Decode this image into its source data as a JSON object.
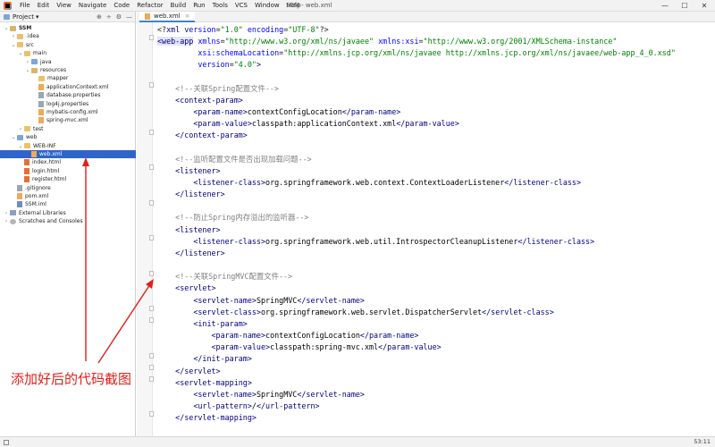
{
  "menu": {
    "items": [
      "File",
      "Edit",
      "View",
      "Navigate",
      "Code",
      "Refactor",
      "Build",
      "Run",
      "Tools",
      "VCS",
      "Window",
      "Help"
    ],
    "window_title": "SSM - web.xml",
    "minimize": "—",
    "maximize": "☐",
    "close": "✕"
  },
  "project_panel": {
    "label": "Project",
    "dropdown": "▾",
    "icons": [
      "⊕",
      "÷",
      "⚙",
      "—"
    ]
  },
  "tree": [
    {
      "label": "SSM",
      "arrow": "v",
      "icon": "folder-gold",
      "bold": true
    },
    {
      "label": ".idea",
      "arrow": ">",
      "icon": "folder"
    },
    {
      "label": "src",
      "arrow": "v",
      "icon": "folder"
    },
    {
      "label": "main",
      "arrow": "v",
      "icon": "folder"
    },
    {
      "label": "java",
      "arrow": ">",
      "icon": "folder-blue"
    },
    {
      "label": "resources",
      "arrow": "v",
      "icon": "folder-gold"
    },
    {
      "label": "mapper",
      "arrow": "",
      "icon": "folder"
    },
    {
      "label": "applicationContext.xml",
      "arrow": "",
      "icon": "file-xml"
    },
    {
      "label": "database.properties",
      "arrow": "",
      "icon": "file-prop"
    },
    {
      "label": "log4j.properties",
      "arrow": "",
      "icon": "file-prop"
    },
    {
      "label": "mybatis-config.xml",
      "arrow": "",
      "icon": "file-xml"
    },
    {
      "label": "spring-mvc.xml",
      "arrow": "",
      "icon": "file-xml"
    },
    {
      "label": "test",
      "arrow": ">",
      "icon": "folder"
    },
    {
      "label": "web",
      "arrow": "v",
      "icon": "folder-blue"
    },
    {
      "label": "WEB-INF",
      "arrow": "v",
      "icon": "folder"
    },
    {
      "label": "web.xml",
      "arrow": "",
      "icon": "file-xml",
      "selected": true
    },
    {
      "label": "index.html",
      "arrow": "",
      "icon": "file-html"
    },
    {
      "label": "login.html",
      "arrow": "",
      "icon": "file-html"
    },
    {
      "label": "register.html",
      "arrow": "",
      "icon": "file-html"
    },
    {
      "label": ".gitignore",
      "arrow": "",
      "icon": "file-prop"
    },
    {
      "label": "pom.xml",
      "arrow": "",
      "icon": "file-xml"
    },
    {
      "label": "SSM.iml",
      "arrow": "",
      "icon": "file-iml"
    },
    {
      "label": "External Libraries",
      "arrow": ">",
      "icon": "lib"
    },
    {
      "label": "Scratches and Consoles",
      "arrow": ">",
      "icon": "scratch"
    }
  ],
  "editor": {
    "tab_label": "web.xml",
    "tab_close": "×"
  },
  "code_lines": [
    [
      [
        "t",
        "<?"
      ],
      [
        "tag",
        "xml "
      ],
      [
        "attr",
        "version"
      ],
      [
        "t",
        "="
      ],
      [
        "val",
        "\"1.0\""
      ],
      [
        "t",
        " "
      ],
      [
        "attr",
        "encoding"
      ],
      [
        "t",
        "="
      ],
      [
        "val",
        "\"UTF-8\""
      ],
      [
        "t",
        "?>"
      ]
    ],
    [
      [
        "tag hl",
        "<web-app"
      ],
      [
        "t",
        " "
      ],
      [
        "attr",
        "xmlns"
      ],
      [
        "t",
        "="
      ],
      [
        "val",
        "\"http://www.w3.org/xml/ns/javaee\""
      ],
      [
        "t",
        " "
      ],
      [
        "attr",
        "xmlns:xsi"
      ],
      [
        "t",
        "="
      ],
      [
        "val",
        "\"http://www.w3.org/2001/XMLSchema-instance\""
      ]
    ],
    [
      [
        "t",
        "         "
      ],
      [
        "attr",
        "xsi:schemaLocation"
      ],
      [
        "t",
        "="
      ],
      [
        "val",
        "\"http://xmlns.jcp.org/xml/ns/javaee http://xmlns.jcp.org/xml/ns/javaee/web-app_4_0.xsd\""
      ]
    ],
    [
      [
        "t",
        "         "
      ],
      [
        "attr",
        "version"
      ],
      [
        "t",
        "="
      ],
      [
        "val",
        "\"4.0\""
      ],
      [
        "tag",
        ">"
      ]
    ],
    [],
    [
      [
        "t",
        "    "
      ],
      [
        "cmt",
        "<!--关联Spring配置文件-->"
      ]
    ],
    [
      [
        "t",
        "    "
      ],
      [
        "tag",
        "<context-param>"
      ]
    ],
    [
      [
        "t",
        "        "
      ],
      [
        "tag",
        "<param-name>"
      ],
      [
        "txt",
        "contextConfigLocation"
      ],
      [
        "tag",
        "</param-name>"
      ]
    ],
    [
      [
        "t",
        "        "
      ],
      [
        "tag",
        "<param-value>"
      ],
      [
        "txt",
        "classpath:applicationContext.xml"
      ],
      [
        "tag",
        "</param-value>"
      ]
    ],
    [
      [
        "t",
        "    "
      ],
      [
        "tag",
        "</context-param>"
      ]
    ],
    [],
    [
      [
        "t",
        "    "
      ],
      [
        "cmt",
        "<!--监听配置文件是否出现加载问题-->"
      ]
    ],
    [
      [
        "t",
        "    "
      ],
      [
        "tag",
        "<listener>"
      ]
    ],
    [
      [
        "t",
        "        "
      ],
      [
        "tag",
        "<listener-class>"
      ],
      [
        "txt",
        "org.springframework.web.context.ContextLoaderListener"
      ],
      [
        "tag",
        "</listener-class>"
      ]
    ],
    [
      [
        "t",
        "    "
      ],
      [
        "tag",
        "</listener>"
      ]
    ],
    [],
    [
      [
        "t",
        "    "
      ],
      [
        "cmt",
        "<!--防止Spring内存溢出的监听器-->"
      ]
    ],
    [
      [
        "t",
        "    "
      ],
      [
        "tag",
        "<listener>"
      ]
    ],
    [
      [
        "t",
        "        "
      ],
      [
        "tag",
        "<listener-class>"
      ],
      [
        "txt",
        "org.springframework.web.util.IntrospectorCleanupListener"
      ],
      [
        "tag",
        "</listener-class>"
      ]
    ],
    [
      [
        "t",
        "    "
      ],
      [
        "tag",
        "</listener>"
      ]
    ],
    [],
    [
      [
        "t",
        "    "
      ],
      [
        "cmt",
        "<!--关联SpringMVC配置文件-->"
      ]
    ],
    [
      [
        "t",
        "    "
      ],
      [
        "tag",
        "<servlet>"
      ]
    ],
    [
      [
        "t",
        "        "
      ],
      [
        "tag",
        "<servlet-name>"
      ],
      [
        "txt",
        "SpringMVC"
      ],
      [
        "tag",
        "</servlet-name>"
      ]
    ],
    [
      [
        "t",
        "        "
      ],
      [
        "tag",
        "<servlet-class>"
      ],
      [
        "txt",
        "org.springframework.web.servlet.DispatcherServlet"
      ],
      [
        "tag",
        "</servlet-class>"
      ]
    ],
    [
      [
        "t",
        "        "
      ],
      [
        "tag",
        "<init-param>"
      ]
    ],
    [
      [
        "t",
        "            "
      ],
      [
        "tag",
        "<param-name>"
      ],
      [
        "txt",
        "contextConfigLocation"
      ],
      [
        "tag",
        "</param-name>"
      ]
    ],
    [
      [
        "t",
        "            "
      ],
      [
        "tag",
        "<param-value>"
      ],
      [
        "txt",
        "classpath:spring-mvc.xml"
      ],
      [
        "tag",
        "</param-value>"
      ]
    ],
    [
      [
        "t",
        "        "
      ],
      [
        "tag",
        "</init-param>"
      ]
    ],
    [
      [
        "t",
        "    "
      ],
      [
        "tag",
        "</servlet>"
      ]
    ],
    [
      [
        "t",
        "    "
      ],
      [
        "tag",
        "<servlet-mapping>"
      ]
    ],
    [
      [
        "t",
        "        "
      ],
      [
        "tag",
        "<servlet-name>"
      ],
      [
        "txt",
        "SpringMVC"
      ],
      [
        "tag",
        "</servlet-name>"
      ]
    ],
    [
      [
        "t",
        "        "
      ],
      [
        "tag",
        "<url-pattern>"
      ],
      [
        "txt",
        "/"
      ],
      [
        "tag",
        "</url-pattern>"
      ]
    ],
    [
      [
        "t",
        "    "
      ],
      [
        "tag",
        "</servlet-mapping>"
      ]
    ]
  ],
  "annotation": {
    "text": "添加好后的代码截图",
    "color": "#e0201c"
  },
  "status": {
    "position": "53:11"
  }
}
